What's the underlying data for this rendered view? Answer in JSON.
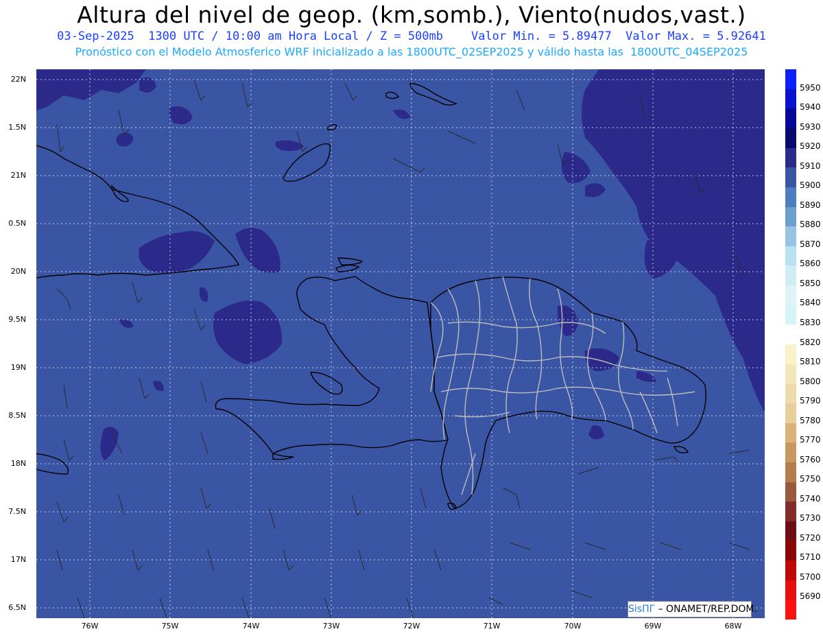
{
  "header": {
    "title": "Altura del nivel de geop. (km,somb.), Viento(nudos,vast.)",
    "subtitle": "03-Sep-2025  1300 UTC / 10:00 am Hora Local / Z = 500mb    Valor Min. = 5.89477  Valor Max. = 5.92641",
    "note": "Pronóstico con el Modelo Atmosferico WRF inicializado a las 1800UTC_02SEP2025 y válido hasta las  1800UTC_04SEP2025"
  },
  "axes": {
    "lat_labels": [
      "22N",
      "1.5N",
      "21N",
      "0.5N",
      "20N",
      "9.5N",
      "19N",
      "8.5N",
      "18N",
      "7.5N",
      "17N",
      "6.5N"
    ],
    "lon_labels": [
      "76W",
      "75W",
      "74W",
      "73W",
      "72W",
      "71W",
      "70W",
      "69W",
      "68W"
    ]
  },
  "colorbar": {
    "labels": [
      "5950",
      "5940",
      "5930",
      "5920",
      "5910",
      "5900",
      "5890",
      "5880",
      "5870",
      "5860",
      "5850",
      "5840",
      "5830",
      "5820",
      "5810",
      "5800",
      "5790",
      "5780",
      "5770",
      "5760",
      "5750",
      "5740",
      "5730",
      "5720",
      "5710",
      "5700",
      "5690"
    ],
    "colors": [
      "#0c20ff",
      "#0a12d0",
      "#06089a",
      "#0a0a6e",
      "#2b2a8a",
      "#3b55a5",
      "#4b7ebf",
      "#6c9fd0",
      "#98c4e4",
      "#b9e1ef",
      "#cfeef4",
      "#dff4f7",
      "#d6f4f7",
      "#ffffff",
      "#f8f1c9",
      "#f3e6b8",
      "#eedbaa",
      "#e9cf9c",
      "#dcb27a",
      "#c99760",
      "#b57c4c",
      "#9a5a3c",
      "#812b2b",
      "#6e0d15",
      "#8b0707",
      "#c20707",
      "#e80e0e",
      "#ff1010"
    ]
  },
  "credit": {
    "brand": "SisПГ",
    "text": "– ONAMET/REP.DOM."
  },
  "colors": {
    "field": "#3b55a5",
    "high": "#2b2a8a",
    "land": "#000000",
    "provinces": "#bdbdbd",
    "barb": "#2a2a2a"
  }
}
